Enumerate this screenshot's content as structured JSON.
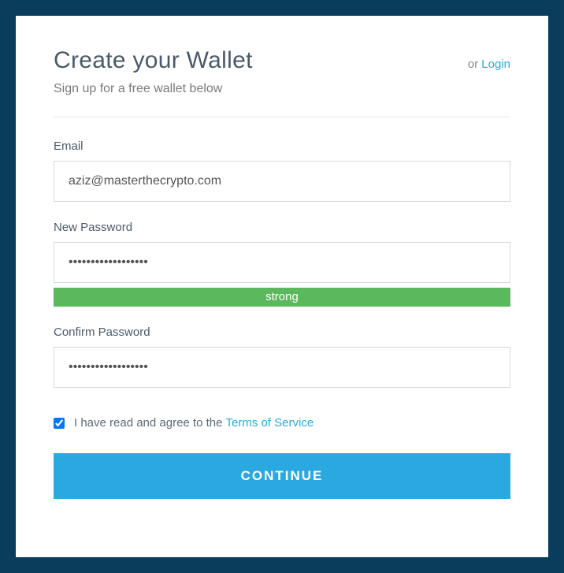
{
  "header": {
    "title": "Create your Wallet",
    "or_text": "or ",
    "login_link": "Login",
    "subtitle": "Sign up for a free wallet below"
  },
  "fields": {
    "email": {
      "label": "Email",
      "value": "aziz@masterthecrypto.com"
    },
    "password": {
      "label": "New Password",
      "value": "••••••••••••••••••",
      "strength_label": "strong",
      "strength_color": "#5cb85c"
    },
    "confirm": {
      "label": "Confirm Password",
      "value": "••••••••••••••••••"
    }
  },
  "terms": {
    "checked": true,
    "text": "I have read and agree to the",
    "link_text": "Terms of Service"
  },
  "button": {
    "continue": "CONTINUE"
  }
}
